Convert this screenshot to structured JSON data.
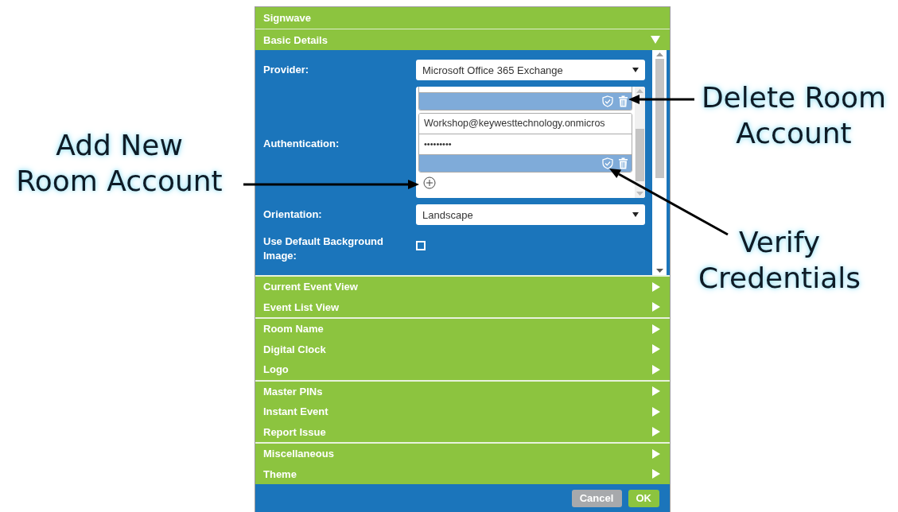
{
  "window": {
    "title": "Signwave"
  },
  "basic_details": {
    "title": "Basic Details",
    "expanded": true,
    "fields": [
      {
        "kind": "select",
        "label": "Provider:",
        "value": "Microsoft Office 365 Exchange"
      },
      {
        "kind": "auth",
        "label": "Authentication:",
        "accounts": [
          {
            "kind": "clipped"
          },
          {
            "kind": "full",
            "email": "Workshop@keywesttechnology.onmicros",
            "password": "•••••••••"
          }
        ]
      },
      {
        "kind": "select",
        "label": "Orientation:",
        "value": "Landscape"
      },
      {
        "kind": "checkbox",
        "label": "Use Default Background Image:",
        "checked": false
      }
    ]
  },
  "section_groups": [
    {
      "items": [
        {
          "title": "Current Event View",
          "expanded": false
        },
        {
          "title": "Event List View",
          "expanded": false
        }
      ]
    },
    {
      "items": [
        {
          "title": "Room Name",
          "expanded": false
        },
        {
          "title": "Digital Clock",
          "expanded": false
        },
        {
          "title": "Logo",
          "expanded": false
        }
      ]
    },
    {
      "items": [
        {
          "title": "Master PINs",
          "expanded": false
        },
        {
          "title": "Instant Event",
          "expanded": false
        },
        {
          "title": "Report Issue",
          "expanded": false
        }
      ]
    },
    {
      "items": [
        {
          "title": "Miscellaneous",
          "expanded": false
        },
        {
          "title": "Theme",
          "expanded": false
        }
      ]
    }
  ],
  "buttons": [
    {
      "label": "Cancel",
      "kind": "secondary"
    },
    {
      "label": "OK",
      "kind": "primary"
    }
  ],
  "annotations": [
    {
      "lines": [
        "Delete Room",
        "Account"
      ]
    },
    {
      "lines": [
        "Add New",
        "Room Account"
      ]
    },
    {
      "lines": [
        "Verify",
        "Credentials"
      ]
    }
  ]
}
